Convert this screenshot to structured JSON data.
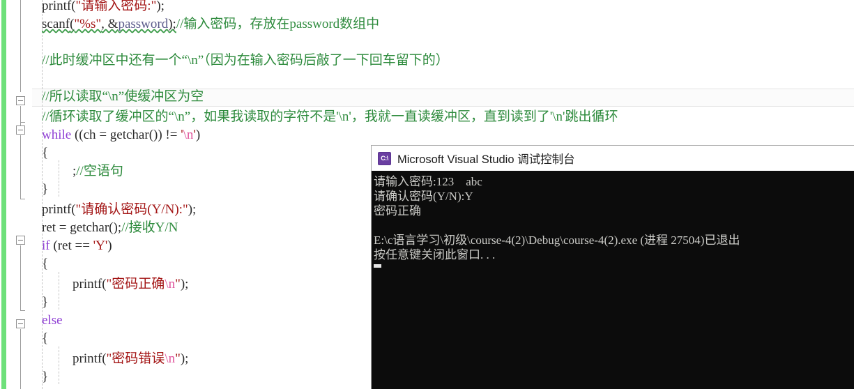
{
  "editor": {
    "name": "visual-studio-code-editor",
    "code_lines": [
      {
        "indent": 0,
        "tokens": [
          {
            "cls": "t-fn",
            "text": "printf"
          },
          {
            "cls": "t-punct",
            "text": "("
          },
          {
            "cls": "t-str",
            "text": "\"请输入密码:\""
          },
          {
            "cls": "t-punct",
            "text": ");"
          }
        ]
      },
      {
        "indent": 0,
        "squiggle": true,
        "tokens": [
          {
            "cls": "t-fn",
            "text": "scanf"
          },
          {
            "cls": "t-punct",
            "text": "("
          },
          {
            "cls": "t-str",
            "text": "\"%s\""
          },
          {
            "cls": "t-punct",
            "text": ", &"
          },
          {
            "cls": "t-var",
            "text": "password"
          },
          {
            "cls": "t-punct",
            "text": ");"
          },
          {
            "cls": "t-cmt",
            "text": "//输入密码，存放在password数组中"
          }
        ]
      },
      {
        "indent": 0,
        "tokens": []
      },
      {
        "indent": 0,
        "tokens": [
          {
            "cls": "t-cmt",
            "text": "//此时缓冲区中还有一个“\\n”（因为在输入密码后敲了一下回车留下的）"
          }
        ]
      },
      {
        "indent": 0,
        "tokens": []
      },
      {
        "indent": 0,
        "tokens": [
          {
            "cls": "t-cmt",
            "text": "//所以读取“\\n”使缓冲区为空"
          }
        ]
      },
      {
        "indent": 0,
        "tokens": [
          {
            "cls": "t-cmt",
            "text": "//循环读取了缓冲区的“\\n”，如果我读取的字符不是'\\n'，我就一直读缓冲区，直到读到了'\\n'跳出循环"
          }
        ]
      },
      {
        "indent": 0,
        "tokens": [
          {
            "cls": "t-kw",
            "text": "while"
          },
          {
            "cls": "t-punct",
            "text": " (("
          },
          {
            "cls": "t-id",
            "text": "ch"
          },
          {
            "cls": "t-punct",
            "text": " = "
          },
          {
            "cls": "t-fn",
            "text": "getchar"
          },
          {
            "cls": "t-punct",
            "text": "()) != "
          },
          {
            "cls": "t-str",
            "text": "'"
          },
          {
            "cls": "t-esc",
            "text": "\\n"
          },
          {
            "cls": "t-str",
            "text": "'"
          },
          {
            "cls": "t-punct",
            "text": ")"
          }
        ]
      },
      {
        "indent": 0,
        "tokens": [
          {
            "cls": "t-punct",
            "text": "{"
          }
        ]
      },
      {
        "indent": 1,
        "tokens": [
          {
            "cls": "t-punct",
            "text": ";"
          },
          {
            "cls": "t-cmt",
            "text": "//空语句"
          }
        ]
      },
      {
        "indent": 0,
        "tokens": [
          {
            "cls": "t-punct",
            "text": "}"
          }
        ]
      },
      {
        "indent": 0,
        "tokens": [
          {
            "cls": "t-fn",
            "text": "printf"
          },
          {
            "cls": "t-punct",
            "text": "("
          },
          {
            "cls": "t-str",
            "text": "\"请确认密码(Y/N):\""
          },
          {
            "cls": "t-punct",
            "text": ");"
          }
        ]
      },
      {
        "indent": 0,
        "tokens": [
          {
            "cls": "t-id",
            "text": "ret"
          },
          {
            "cls": "t-punct",
            "text": " = "
          },
          {
            "cls": "t-fn",
            "text": "getchar"
          },
          {
            "cls": "t-punct",
            "text": "();"
          },
          {
            "cls": "t-cmt",
            "text": "//接收Y/N"
          }
        ]
      },
      {
        "indent": 0,
        "tokens": [
          {
            "cls": "t-kw",
            "text": "if"
          },
          {
            "cls": "t-punct",
            "text": " ("
          },
          {
            "cls": "t-id",
            "text": "ret"
          },
          {
            "cls": "t-punct",
            "text": " == "
          },
          {
            "cls": "t-str",
            "text": "'Y'"
          },
          {
            "cls": "t-punct",
            "text": ")"
          }
        ]
      },
      {
        "indent": 0,
        "tokens": [
          {
            "cls": "t-punct",
            "text": "{"
          }
        ]
      },
      {
        "indent": 1,
        "tokens": [
          {
            "cls": "t-fn",
            "text": "printf"
          },
          {
            "cls": "t-punct",
            "text": "("
          },
          {
            "cls": "t-str",
            "text": "\"密码正确"
          },
          {
            "cls": "t-esc",
            "text": "\\n"
          },
          {
            "cls": "t-str",
            "text": "\""
          },
          {
            "cls": "t-punct",
            "text": ");"
          }
        ]
      },
      {
        "indent": 0,
        "tokens": [
          {
            "cls": "t-punct",
            "text": "}"
          }
        ]
      },
      {
        "indent": 0,
        "tokens": [
          {
            "cls": "t-kw",
            "text": "else"
          }
        ]
      },
      {
        "indent": 0,
        "tokens": [
          {
            "cls": "t-punct",
            "text": "{"
          }
        ]
      },
      {
        "indent": 1,
        "tokens": [
          {
            "cls": "t-fn",
            "text": "printf"
          },
          {
            "cls": "t-punct",
            "text": "("
          },
          {
            "cls": "t-str",
            "text": "\"密码错误"
          },
          {
            "cls": "t-esc",
            "text": "\\n"
          },
          {
            "cls": "t-str",
            "text": "\""
          },
          {
            "cls": "t-punct",
            "text": ");"
          }
        ]
      },
      {
        "indent": 0,
        "tokens": [
          {
            "cls": "t-punct",
            "text": "}"
          }
        ]
      }
    ],
    "colors": {
      "change_bar": "#6ee07a",
      "string": "#a31515",
      "comment": "#2e8b3d",
      "keyword": "#8f3fd4",
      "escape": "#e0529a",
      "background": "#ffffff"
    },
    "fold_boxes_label": "collapse-outlining-box",
    "current_line_index": 5
  },
  "console": {
    "title": "Microsoft Visual Studio 调试控制台",
    "icon_glyph": "C:\\",
    "icon_name": "console-app-icon",
    "background": "#0c0c0c",
    "text_color": "#ccccc8",
    "lines": [
      "请输入密码:123    abc",
      "请确认密码(Y/N):Y",
      "密码正确",
      "",
      "E:\\c语言学习\\初级\\course-4(2)\\Debug\\course-4(2).exe (进程 27504)已退出",
      "按任意键关闭此窗口. . ."
    ]
  }
}
